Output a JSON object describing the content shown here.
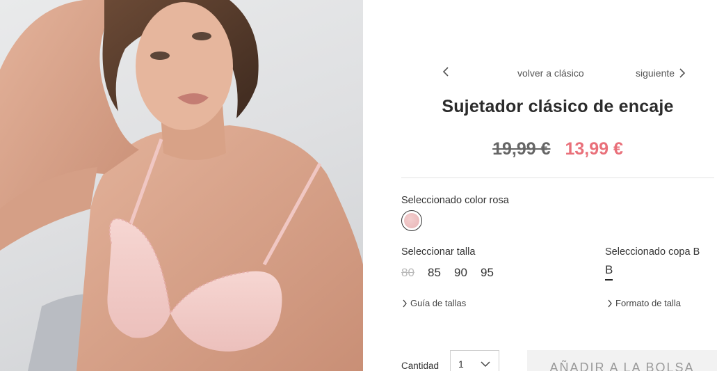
{
  "product": {
    "image_alt": "Modelo con sujetador de encaje rosa",
    "title": "Sujetador clásico de encaje",
    "price_original": "19,99 €",
    "price_sale": "13,99 €"
  },
  "navigation": {
    "prev_icon": "chevron-left-icon",
    "back_label": "volver a clásico",
    "next_label": "siguiente",
    "next_icon": "chevron-right-icon"
  },
  "color": {
    "label": "Seleccionado color rosa",
    "swatch_hex": "#e8b4b6"
  },
  "size": {
    "label": "Seleccionar talla",
    "options": [
      {
        "value": "80",
        "available": false
      },
      {
        "value": "85",
        "available": true
      },
      {
        "value": "90",
        "available": true
      },
      {
        "value": "95",
        "available": true
      }
    ],
    "guide_link": "Guía de tallas"
  },
  "cup": {
    "label": "Seleccionado copa B",
    "value": "B",
    "format_link": "Formato de talla"
  },
  "quantity": {
    "label": "Cantidad",
    "value": "1"
  },
  "cart": {
    "add_label": "AÑADIR A LA BOLSA"
  },
  "colors": {
    "sale_price": "#e9707a",
    "button_bg": "#f2f2f2",
    "button_text": "#9a9a9a"
  }
}
